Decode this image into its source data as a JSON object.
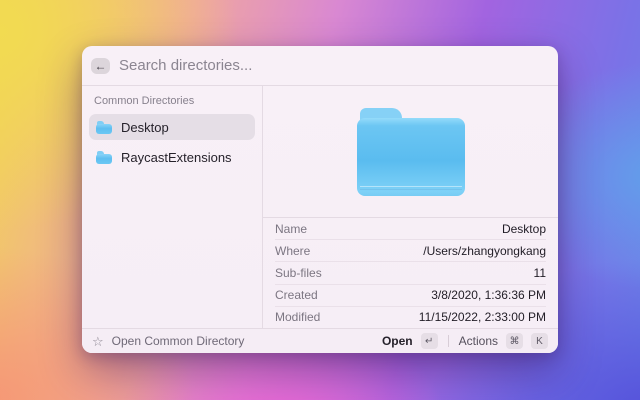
{
  "window": {
    "search": {
      "placeholder": "Search directories...",
      "back_icon_glyph": "←"
    },
    "sidebar": {
      "section_label": "Common Directories",
      "items": [
        {
          "label": "Desktop",
          "selected": true
        },
        {
          "label": "RaycastExtensions",
          "selected": false
        }
      ]
    },
    "details": {
      "rows": [
        {
          "label": "Name",
          "value": "Desktop"
        },
        {
          "label": "Where",
          "value": "/Users/zhangyongkang"
        },
        {
          "label": "Sub-files",
          "value": "11"
        },
        {
          "label": "Created",
          "value": "3/8/2020, 1:36:36 PM"
        },
        {
          "label": "Modified",
          "value": "11/15/2022, 2:33:00 PM"
        }
      ]
    },
    "statusbar": {
      "star_icon_glyph": "☆",
      "left_label": "Open Common Directory",
      "primary_action": "Open",
      "primary_key": "↵",
      "secondary_action": "Actions",
      "secondary_keys": [
        "⌘",
        "K"
      ]
    }
  },
  "colors": {
    "folder_blue": "#5ABCEF",
    "selection_bg": "#E5DEE6",
    "window_bg": "#F6EEF6",
    "divider": "#E4DAE3"
  }
}
